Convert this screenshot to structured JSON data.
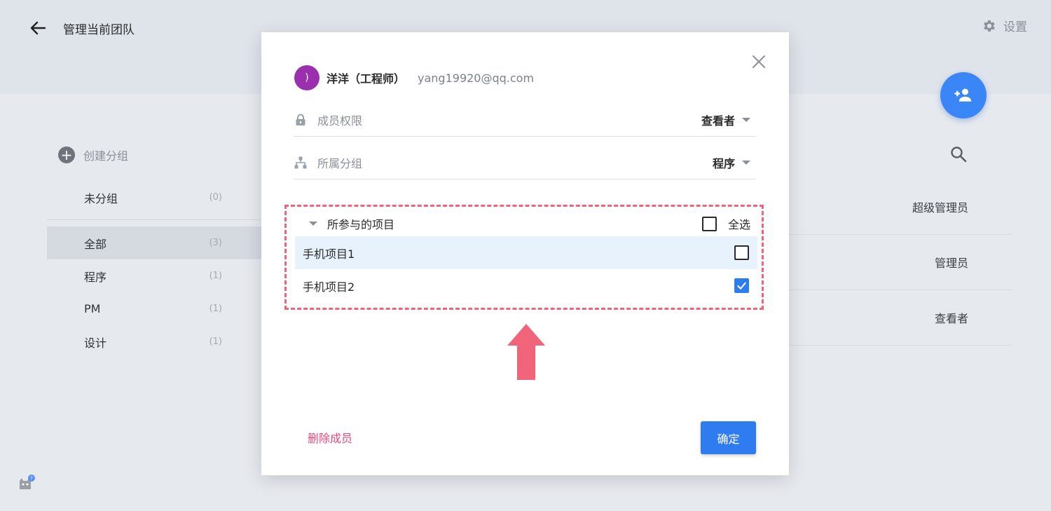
{
  "header": {
    "back_icon": "arrow-left-icon",
    "title": "管理当前团队",
    "settings_label": "设置",
    "settings_icon": "gear-icon"
  },
  "fab": {
    "icon": "add-person-icon"
  },
  "sidebar": {
    "create_group_label": "创建分组",
    "ungrouped": {
      "label": "未分组",
      "count": "(0)"
    },
    "groups": [
      {
        "label": "全部",
        "count": "(3)",
        "active": true
      },
      {
        "label": "程序",
        "count": "(1)"
      },
      {
        "label": "PM",
        "count": "(1)"
      },
      {
        "label": "设计",
        "count": "(1)"
      }
    ]
  },
  "members": {
    "search_icon": "search-icon",
    "roles": [
      "超级管理员",
      "管理员",
      "查看者"
    ]
  },
  "modal": {
    "close_icon": "close-icon",
    "user": {
      "avatar_text": ")",
      "avatar_color": "#9b2fae",
      "name": "洋洋（工程师）",
      "email": "yang19920@qq.com"
    },
    "permission": {
      "label": "成员权限",
      "value": "查看者",
      "icon": "lock-icon"
    },
    "group": {
      "label": "所属分组",
      "value": "程序",
      "icon": "org-chart-icon"
    },
    "projects": {
      "title": "所参与的项目",
      "select_all_label": "全选",
      "select_all_checked": false,
      "items": [
        {
          "label": "手机项目1",
          "checked": false
        },
        {
          "label": "手机项目2",
          "checked": true
        }
      ]
    },
    "delete_label": "删除成员",
    "confirm_label": "确定"
  },
  "colors": {
    "accent": "#2f7cf1",
    "annotation": "#f0657a",
    "delete": "#e84a7c"
  }
}
